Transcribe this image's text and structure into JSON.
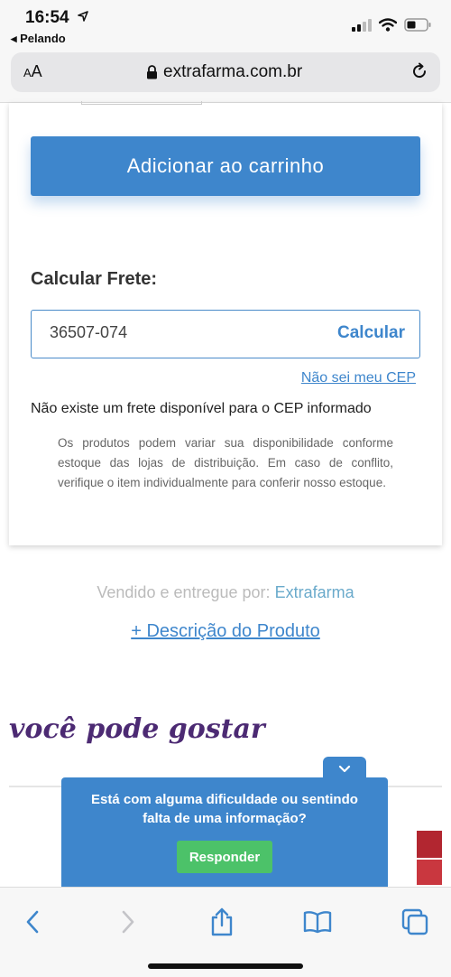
{
  "status_bar": {
    "time": "16:54",
    "back_app": "◂ Pelando"
  },
  "browser": {
    "text_size_label_small": "A",
    "text_size_label_large": "A",
    "url": "extrafarma.com.br"
  },
  "product": {
    "add_to_cart_label": "Adicionar ao carrinho",
    "shipping": {
      "title": "Calcular Frete:",
      "cep_value": "36507-074",
      "calculate_label": "Calcular",
      "unknown_cep_link": "Não sei meu CEP",
      "result_message": "Não existe um frete disponível para o CEP informado",
      "disclaimer": "Os produtos podem variar sua disponibilidade conforme estoque das lojas de distribuição. Em caso de conflito, verifique o item individualmente para conferir nosso estoque."
    },
    "sold_by_prefix": "Vendido e entregue por:",
    "sold_by_brand": "Extrafarma",
    "description_link": "+ Descrição do Produto"
  },
  "recommendations": {
    "title": "você pode gostar"
  },
  "help_popup": {
    "question": "Está com alguma dificuldade ou sentindo falta de uma informação?",
    "answer_button": "Responder"
  },
  "toolbar": {
    "icons": [
      "back-icon",
      "forward-icon",
      "share-icon",
      "bookmarks-icon",
      "tabs-icon"
    ]
  },
  "colors": {
    "primary_blue": "#3e86cc",
    "green_button": "#4cc269",
    "section_title": "#4c2a73"
  }
}
